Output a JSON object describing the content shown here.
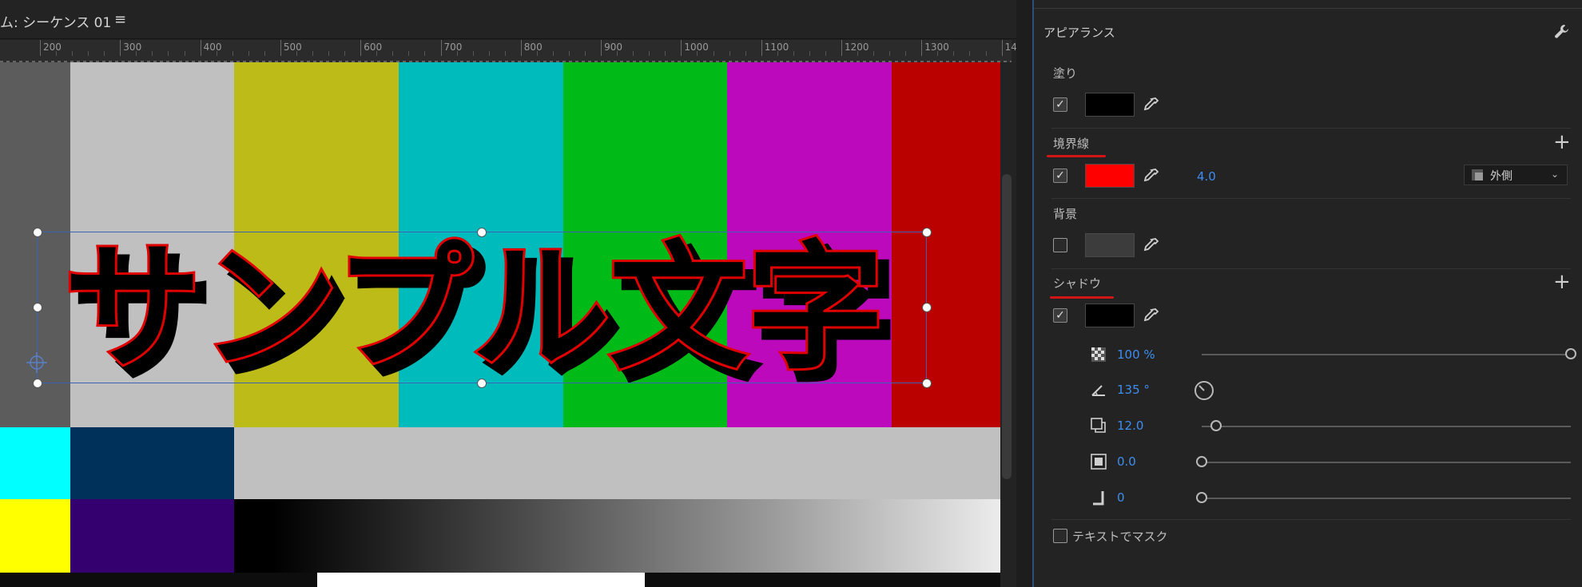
{
  "monitor": {
    "title": "ム: シーケンス 01",
    "menu_icon": "hamburger-menu-icon",
    "ruler_ticks": [
      "200",
      "300",
      "400",
      "500",
      "600",
      "700",
      "800",
      "900",
      "1000",
      "1100",
      "1200",
      "1300",
      "14"
    ]
  },
  "canvas": {
    "title_text": "サンプル文字",
    "colors": {
      "fill": "#000000",
      "stroke": "#e00000",
      "top_bars": [
        "#5c5c5c",
        "#c0c0c0",
        "#bdbb18",
        "#00bbbb",
        "#00bb17",
        "#bb09bb",
        "#bb0000"
      ],
      "mid_bars": [
        "#00ffff",
        "#00315a",
        "#c0c0c0"
      ],
      "bottom_bars": [
        "#ffff00",
        "#340070"
      ]
    }
  },
  "panel": {
    "title": "アピアランス",
    "wrench_icon": "wrench-icon",
    "fill": {
      "label": "塗り",
      "checked": true,
      "color": "#000000"
    },
    "stroke": {
      "label": "境界線",
      "checked": true,
      "color": "#ff0000",
      "width": "4.0",
      "position": "外側"
    },
    "background": {
      "label": "背景",
      "checked": false,
      "color": "#3c3c3c"
    },
    "shadow": {
      "label": "シャドウ",
      "checked": true,
      "color": "#000000",
      "opacity": "100 %",
      "opacity_value": 1.0,
      "angle": "135 °",
      "distance": "12.0",
      "distance_value": 0.04,
      "size": "0.0",
      "size_value": 0.0,
      "blur": "0",
      "blur_value": 0.0
    },
    "text_mask": {
      "label": "テキストでマスク",
      "checked": false
    }
  }
}
